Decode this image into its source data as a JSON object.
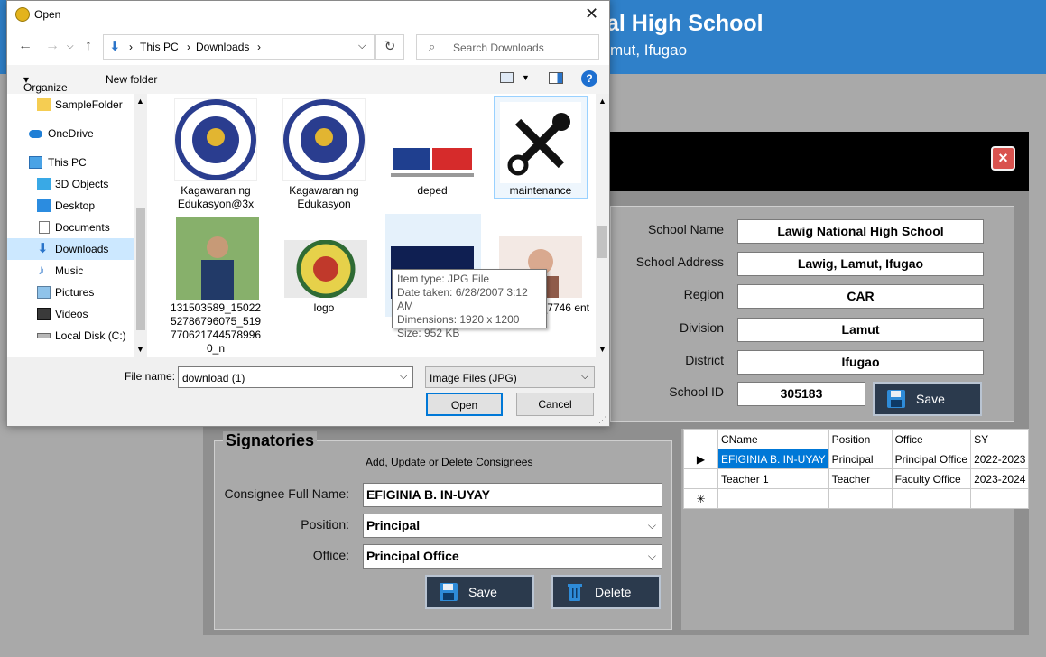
{
  "app": {
    "title": "al High School",
    "subtitle": "mut, Ifugao",
    "school_form": {
      "labels": [
        "School Name",
        "School Address",
        "Region",
        "Division",
        "District",
        "School ID"
      ],
      "values": [
        "Lawig National High School",
        "Lawig, Lamut, Ifugao",
        "CAR",
        "Lamut",
        "Ifugao",
        "305183"
      ],
      "save_label": "Save"
    },
    "signatories": {
      "title": "Signatories",
      "caption": "Add, Update or Delete Consignees",
      "name_label": "Consignee Full Name:",
      "name_value": "EFIGINIA B. IN-UYAY",
      "position_label": "Position:",
      "position_value": "Principal",
      "office_label": "Office:",
      "office_value": "Principal Office",
      "save_label": "Save",
      "delete_label": "Delete"
    },
    "grid": {
      "columns": [
        "CName",
        "Position",
        "Office",
        "SY"
      ],
      "rows": [
        [
          "EFIGINIA B. IN-UYAY",
          "Principal",
          "Principal Office",
          "2022-2023"
        ],
        [
          "Teacher 1",
          "Teacher",
          "Faculty Office",
          "2023-2024"
        ]
      ]
    }
  },
  "dialog": {
    "title": "Open",
    "breadcrumb": [
      "This PC",
      "Downloads"
    ],
    "search_placeholder": "Search Downloads",
    "toolbar": {
      "organize": "Organize",
      "new_folder": "New folder"
    },
    "nav": [
      "SampleFolder",
      "OneDrive",
      "This PC",
      "3D Objects",
      "Desktop",
      "Documents",
      "Downloads",
      "Music",
      "Pictures",
      "Videos",
      "Local Disk (C:)"
    ],
    "files": [
      {
        "name": "Kagawaran ng Edukasyon@3x"
      },
      {
        "name": "Kagawaran ng Edukasyon"
      },
      {
        "name": "deped"
      },
      {
        "name": "maintenance"
      },
      {
        "name": "131503589_15022 52786796075_519 770621744578996 0_n"
      },
      {
        "name": "logo"
      },
      {
        "name": ""
      },
      {
        "name": "_7746 ent"
      }
    ],
    "tooltip": [
      "Item type: JPG File",
      "Date taken: 6/28/2007 3:12 AM",
      "Dimensions: 1920 x 1200",
      "Size: 952 KB"
    ],
    "filename_label": "File name:",
    "filename_value": "download (1)",
    "filter_value": "Image Files (JPG)",
    "open_label": "Open",
    "cancel_label": "Cancel"
  }
}
